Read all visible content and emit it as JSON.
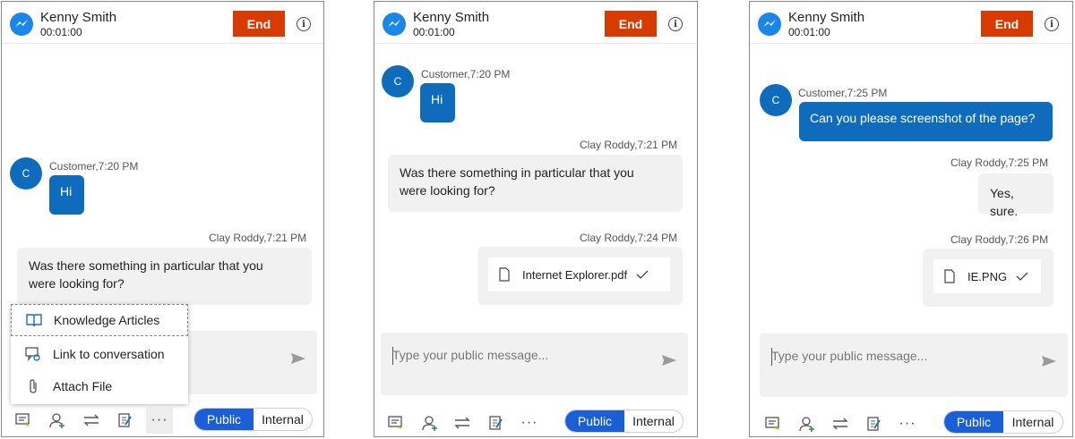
{
  "panels": [
    {
      "header": {
        "name": "Kenny Smith",
        "timer": "00:01:00",
        "end_label": "End",
        "info_glyph": "i"
      },
      "messages": {
        "customer_avatar": "C",
        "customer_meta": "Customer,7:20 PM",
        "customer_text": "Hi",
        "agent_meta": "Clay Roddy,7:21 PM",
        "agent_text_1": "Was there something in particular that you",
        "agent_text_2": "were looking for?"
      },
      "menu": {
        "items": [
          "Knowledge Articles",
          "Link to conversation",
          "Attach File"
        ]
      },
      "toolbar": {
        "more_label": "···",
        "public_label": "Public",
        "internal_label": "Internal"
      }
    },
    {
      "header": {
        "name": "Kenny Smith",
        "timer": "00:01:00",
        "end_label": "End",
        "info_glyph": "i"
      },
      "messages": {
        "customer_avatar": "C",
        "customer_meta": "Customer,7:20 PM",
        "customer_text": "Hi",
        "agent_meta": "Clay Roddy,7:21 PM",
        "agent_text_1": "Was there something in particular that you",
        "agent_text_2": "were looking for?",
        "file_meta": "Clay Roddy,7:24 PM",
        "file_name": "Internet Explorer.pdf"
      },
      "input": {
        "placeholder": "Type your public message..."
      },
      "toolbar": {
        "more_label": "···",
        "public_label": "Public",
        "internal_label": "Internal"
      }
    },
    {
      "header": {
        "name": "Kenny Smith",
        "timer": "00:01:00",
        "end_label": "End",
        "info_glyph": "i"
      },
      "messages": {
        "customer_avatar": "C",
        "customer_meta": "Customer,7:25 PM",
        "customer_text": "Can you please screenshot of the page?",
        "agent_meta": "Clay Roddy,7:25 PM",
        "agent_text": "Yes, sure.",
        "file_meta": "Clay Roddy,7:26 PM",
        "file_name": "IE.PNG"
      },
      "input": {
        "placeholder": "Type your public message..."
      },
      "toolbar": {
        "more_label": "···",
        "public_label": "Public",
        "internal_label": "Internal"
      }
    }
  ],
  "colors": {
    "accent": "#0f6cbd",
    "end_button": "#d83b01",
    "toggle_active": "#1a5fd6",
    "bubble_grey": "#f1f1f1"
  }
}
